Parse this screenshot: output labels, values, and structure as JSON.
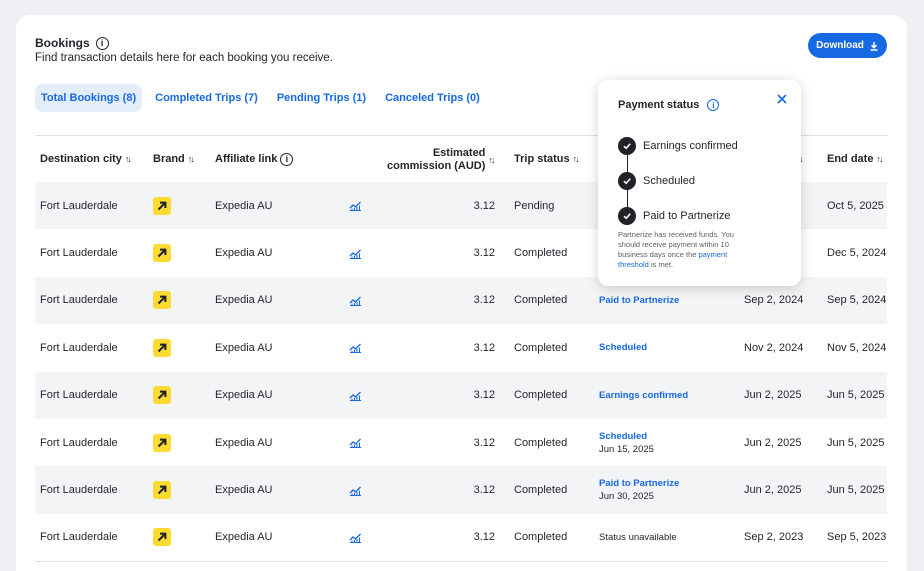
{
  "header": {
    "title": "Bookings",
    "subtitle": "Find transaction details here for each booking you receive.",
    "download_label": "Download"
  },
  "tabs": [
    {
      "label": "Total Bookings (8)",
      "active": true
    },
    {
      "label": "Completed Trips (7)",
      "active": false
    },
    {
      "label": "Pending Trips (1)",
      "active": false
    },
    {
      "label": "Canceled Trips (0)",
      "active": false
    }
  ],
  "table": {
    "columns": {
      "destination": "Destination city",
      "brand": "Brand",
      "affiliate": "Affiliate link",
      "commission_line1": "Estimated",
      "commission_line2": "commission (AUD)",
      "trip_status": "Trip status",
      "end_date": "End date"
    },
    "rows": [
      {
        "city": "Fort Lauderdale",
        "affiliate": "Expedia AU",
        "commission": "3.12",
        "trip_status": "Pending",
        "payment_status": "",
        "payment_date": "",
        "start_date": "",
        "end_date": "Oct 5, 2025"
      },
      {
        "city": "Fort Lauderdale",
        "affiliate": "Expedia AU",
        "commission": "3.12",
        "trip_status": "Completed",
        "payment_status": "",
        "payment_date": "",
        "start_date": "",
        "end_date": "Dec 5, 2024"
      },
      {
        "city": "Fort Lauderdale",
        "affiliate": "Expedia AU",
        "commission": "3.12",
        "trip_status": "Completed",
        "payment_status": "Paid to Partnerize",
        "payment_date": "",
        "start_date": "Sep 2, 2024",
        "end_date": "Sep 5, 2024"
      },
      {
        "city": "Fort Lauderdale",
        "affiliate": "Expedia AU",
        "commission": "3.12",
        "trip_status": "Completed",
        "payment_status": "Scheduled",
        "payment_date": "",
        "start_date": "Nov 2, 2024",
        "end_date": "Nov 5, 2024"
      },
      {
        "city": "Fort Lauderdale",
        "affiliate": "Expedia AU",
        "commission": "3.12",
        "trip_status": "Completed",
        "payment_status": "Earnings confirmed",
        "payment_date": "",
        "start_date": "Jun 2, 2025",
        "end_date": "Jun 5, 2025"
      },
      {
        "city": "Fort Lauderdale",
        "affiliate": "Expedia AU",
        "commission": "3.12",
        "trip_status": "Completed",
        "payment_status": "Scheduled",
        "payment_date": "Jun 15, 2025",
        "start_date": "Jun 2, 2025",
        "end_date": "Jun 5, 2025"
      },
      {
        "city": "Fort Lauderdale",
        "affiliate": "Expedia AU",
        "commission": "3.12",
        "trip_status": "Completed",
        "payment_status": "Paid to Partnerize",
        "payment_date": "Jun 30, 2025",
        "start_date": "Jun 2, 2025",
        "end_date": "Jun 5, 2025"
      },
      {
        "city": "Fort Lauderdale",
        "affiliate": "Expedia AU",
        "commission": "3.12",
        "trip_status": "Completed",
        "payment_status": "Status unavailable",
        "payment_date": "",
        "start_date": "Sep 2, 2023",
        "end_date": "Sep 5, 2023"
      }
    ]
  },
  "popover": {
    "title": "Payment status",
    "steps": [
      "Earnings confirmed",
      "Scheduled",
      "Paid to Partnerize"
    ],
    "note_before": "Partnerize has received funds. You should receive payment within 10 business days once the ",
    "note_link": "payment threshold",
    "note_after": " is met."
  },
  "colors": {
    "accent": "#1668e3",
    "brand_yellow": "#fddb32",
    "row_alt": "#f3f4f6"
  }
}
